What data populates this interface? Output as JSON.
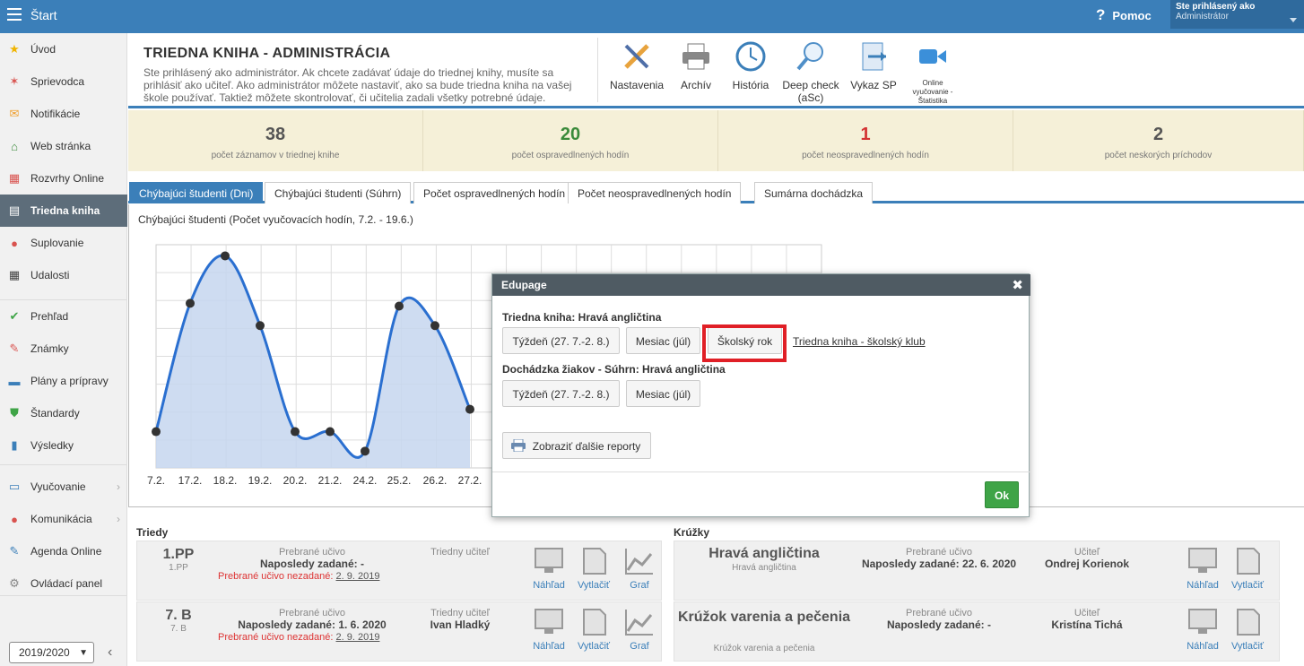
{
  "topbar": {
    "start": "Štart",
    "help": "Pomoc",
    "user_line1": "Ste prihlásený ako",
    "user_line2": "Administrátor"
  },
  "sidebar": {
    "items": [
      {
        "label": "Úvod",
        "icon": "star-icon",
        "color": "#f0b400"
      },
      {
        "label": "Sprievodca",
        "icon": "wand-icon",
        "color": "#d9534f"
      },
      {
        "label": "Notifikácie",
        "icon": "envelope-icon",
        "color": "#f0a030"
      },
      {
        "label": "Web stránka",
        "icon": "house-icon",
        "color": "#3a8a3a"
      },
      {
        "label": "Rozvrhy Online",
        "icon": "calendar-icon",
        "color": "#d9534f"
      },
      {
        "label": "Triedna kniha",
        "icon": "book-icon",
        "color": "#ffffff"
      },
      {
        "label": "Suplovanie",
        "icon": "person-icon",
        "color": "#d9534f"
      },
      {
        "label": "Udalosti",
        "icon": "calendar-grid-icon",
        "color": "#444444"
      },
      {
        "label": "Prehľad",
        "icon": "check-circle-icon",
        "color": "#3fa447"
      },
      {
        "label": "Známky",
        "icon": "grade-icon",
        "color": "#d9534f"
      },
      {
        "label": "Plány a prípravy",
        "icon": "briefcase-icon",
        "color": "#3b7fb9"
      },
      {
        "label": "Štandardy",
        "icon": "shield-check-icon",
        "color": "#3fa447"
      },
      {
        "label": "Výsledky",
        "icon": "bar-chart-icon",
        "color": "#3b7fb9"
      },
      {
        "label": "Vyučovanie",
        "icon": "open-book-icon",
        "color": "#3b7fb9"
      },
      {
        "label": "Komunikácia",
        "icon": "chat-icon",
        "color": "#d9534f"
      },
      {
        "label": "Agenda Online",
        "icon": "pencil-icon",
        "color": "#3b7fb9"
      },
      {
        "label": "Ovládací panel",
        "icon": "gear-icon",
        "color": "#888888"
      }
    ],
    "year": "2019/2020"
  },
  "header": {
    "title": "TRIEDNA KNIHA - ADMINISTRÁCIA",
    "description": "Ste prihlásený ako administrátor. Ak chcete zadávať údaje do triednej knihy, musíte sa prihlásiť ako učiteľ. Ako administrátor môžete nastaviť, ako sa bude triedna kniha na vašej škole používať. Taktiež môžete skontrolovať, či učitelia zadali všetky potrebné údaje.",
    "buttons": [
      {
        "label": "Nastavenia",
        "icon": "settings-tools-icon"
      },
      {
        "label": "Archív",
        "icon": "printer-icon"
      },
      {
        "label": "História",
        "icon": "clock-icon"
      },
      {
        "label": "Deep check (aSc)",
        "icon": "magnifier-icon"
      },
      {
        "label": "Vykaz SP",
        "icon": "export-icon"
      },
      {
        "label": "Online vyučovanie - Štatistika",
        "icon": "video-camera-icon"
      }
    ]
  },
  "stats": [
    {
      "value": "38",
      "caption": "počet záznamov v triednej knihe",
      "color": "#555555"
    },
    {
      "value": "20",
      "caption": "počet ospravedlnených hodín",
      "color": "#3a8a3a"
    },
    {
      "value": "1",
      "caption": "počet neospravedlnených hodín",
      "color": "#d33333"
    },
    {
      "value": "2",
      "caption": "počet neskorých príchodov",
      "color": "#555555"
    }
  ],
  "tabs": [
    "Chýbajúci študenti (Dni)",
    "Chýbajúci študenti (Súhrn)",
    "Počet ospravedlnených hodín",
    "Počet neospravedlnených hodín",
    "Sumárna dochádzka"
  ],
  "chart_title": "Chýbajúci študenti (Počet vyučovacích hodín, 7.2. - 19.6.)",
  "chart_data": {
    "type": "area",
    "categories": [
      "7.2.",
      "17.2.",
      "18.2.",
      "19.2.",
      "20.2.",
      "21.2.",
      "24.2.",
      "25.2.",
      "26.2.",
      "27.2."
    ],
    "values": [
      1.3,
      5.9,
      7.6,
      5.1,
      1.3,
      1.3,
      0.6,
      5.8,
      5.1,
      2.1
    ],
    "ylim": [
      0,
      8
    ],
    "grid": true,
    "line_color": "#2a6fd0",
    "fill_color": "#c5d6ee"
  },
  "lower": {
    "classes_title": "Triedy",
    "clubs_title": "Krúžky",
    "classes": [
      {
        "name": "1.PP",
        "sub": "1.PP",
        "taught_label": "Prebrané učivo",
        "last_label": "Naposledy zadané: -",
        "warn_label": "Prebrané učivo nezadané:",
        "warn_date": "2. 9. 2019",
        "teacher_label": "Triedny učiteľ",
        "teacher": ""
      },
      {
        "name": "7. B",
        "sub": "7. B",
        "taught_label": "Prebrané učivo",
        "last_label": "Naposledy zadané: 1. 6. 2020",
        "warn_label": "Prebrané učivo nezadané:",
        "warn_date": "2. 9. 2019",
        "teacher_label": "Triedny učiteľ",
        "teacher": "Ivan Hladký"
      }
    ],
    "clubs": [
      {
        "name": "Hravá angličtina",
        "sub": "Hravá angličtina",
        "taught_label": "Prebrané učivo",
        "last_label": "Naposledy zadané: 22. 6. 2020",
        "teacher_label": "Učiteľ",
        "teacher": "Ondrej Korienok"
      },
      {
        "name": "Krúžok varenia a pečenia",
        "sub": "Krúžok varenia a pečenia",
        "taught_label": "Prebrané učivo",
        "last_label": "Naposledy zadané: -",
        "teacher_label": "Učiteľ",
        "teacher": "Kristína Tichá"
      }
    ],
    "actions": {
      "preview": "Náhľad",
      "print": "Vytlačiť",
      "graph": "Graf"
    }
  },
  "dialog": {
    "title": "Edupage",
    "section1": "Triedna kniha: Hravá angličtina",
    "week1": "Týždeň (27. 7.-2. 8.)",
    "month1": "Mesiac (júl)",
    "year1": "Školský rok",
    "link": "Triedna kniha - školský klub",
    "section2": "Dochádzka žiakov - Súhrn: Hravá angličtina",
    "week2": "Týždeň (27. 7.-2. 8.)",
    "month2": "Mesiac (júl)",
    "more": "Zobraziť ďalšie reporty",
    "ok": "Ok"
  }
}
